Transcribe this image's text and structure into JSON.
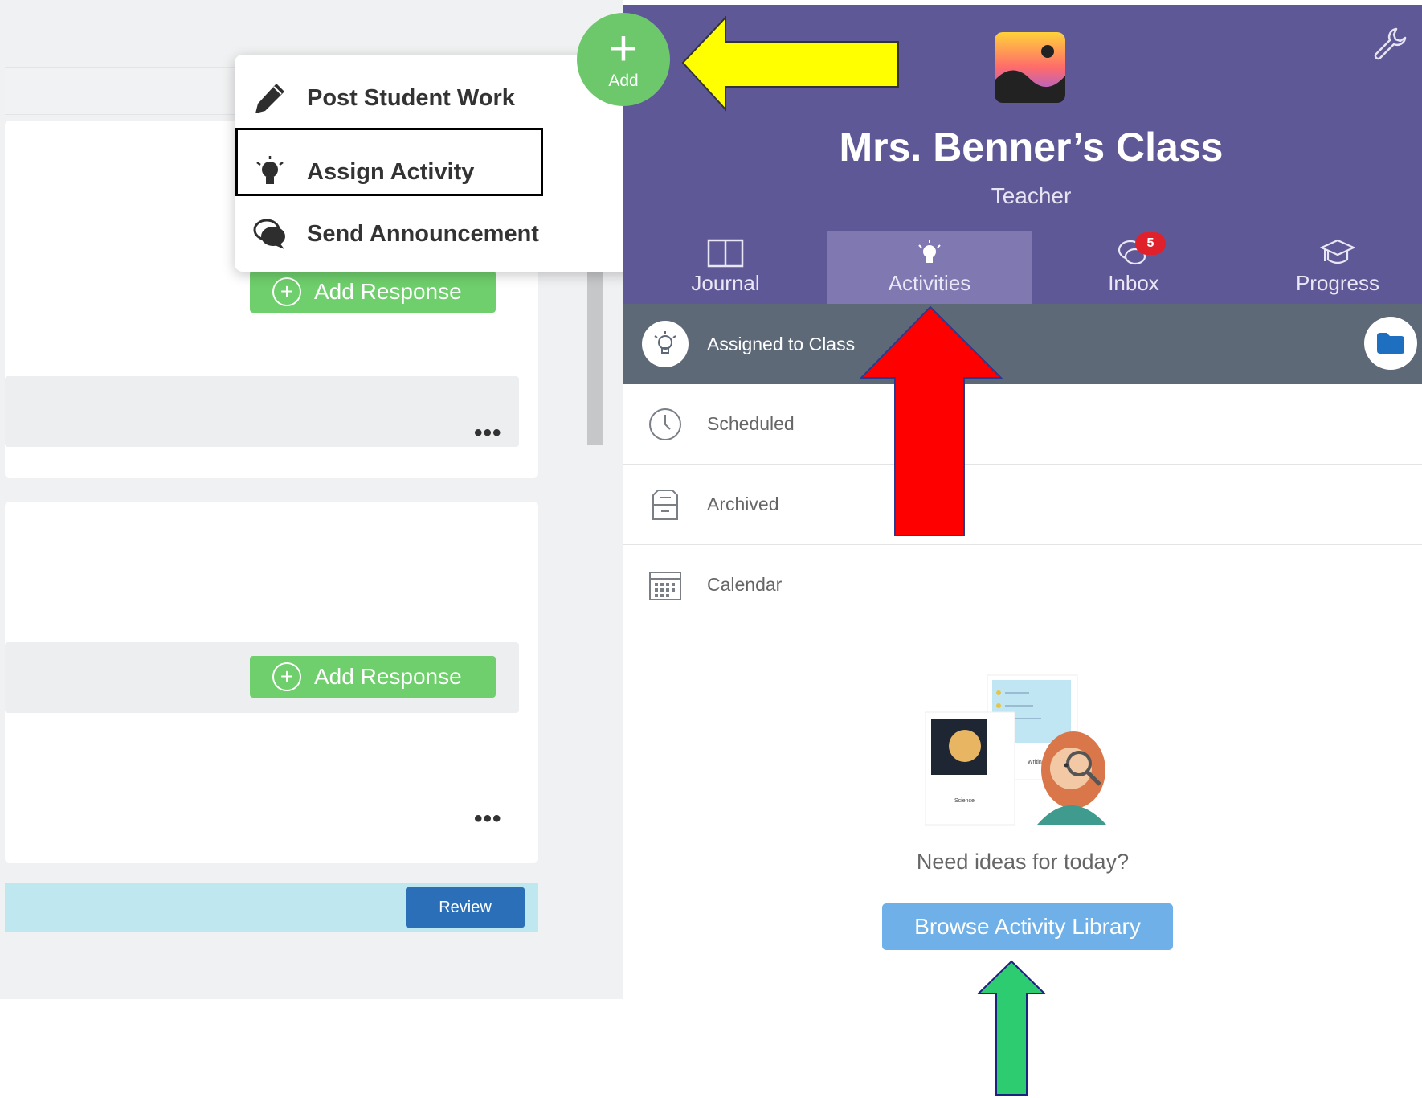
{
  "feed": {
    "add_response_label_1": "Add Response",
    "add_response_label_2": "Add Response",
    "more_label_1": "•••",
    "more_label_2": "•••",
    "review_label": "Review"
  },
  "add_menu": {
    "items": [
      {
        "label": "Post Student Work",
        "icon": "pencil-icon"
      },
      {
        "label": "Assign Activity",
        "icon": "lightbulb-icon"
      },
      {
        "label": "Send Announcement",
        "icon": "chat-bubbles-icon"
      }
    ]
  },
  "fab": {
    "plus": "+",
    "label": "Add"
  },
  "header": {
    "class_title": "Mrs. Benner’s Class",
    "role": "Teacher"
  },
  "tabs": [
    {
      "label": "Journal",
      "icon": "book-icon"
    },
    {
      "label": "Activities",
      "icon": "lightbulb-icon",
      "active": true
    },
    {
      "label": "Inbox",
      "icon": "chat-icon",
      "badge": "5"
    },
    {
      "label": "Progress",
      "icon": "graduation-cap-icon"
    }
  ],
  "activity_list": [
    {
      "label": "Assigned to Class",
      "icon": "lightbulb-icon"
    },
    {
      "label": "Scheduled",
      "icon": "clock-icon"
    },
    {
      "label": "Archived",
      "icon": "archive-icon"
    },
    {
      "label": "Calendar",
      "icon": "calendar-icon"
    }
  ],
  "empty_state": {
    "prompt": "Need ideas for today?",
    "browse_label": "Browse Activity Library",
    "card_labels": [
      "Science",
      "Writing"
    ]
  },
  "colors": {
    "header_purple": "#5f5896",
    "active_tab": "#8078b0",
    "add_green": "#6cc86a",
    "browse_blue": "#6fb0e8",
    "review_blue": "#2b6fb8",
    "badge_red": "#e0212b",
    "arrow_yellow": "#ffff00",
    "arrow_red": "#ff0000",
    "arrow_green": "#2ecc71"
  }
}
